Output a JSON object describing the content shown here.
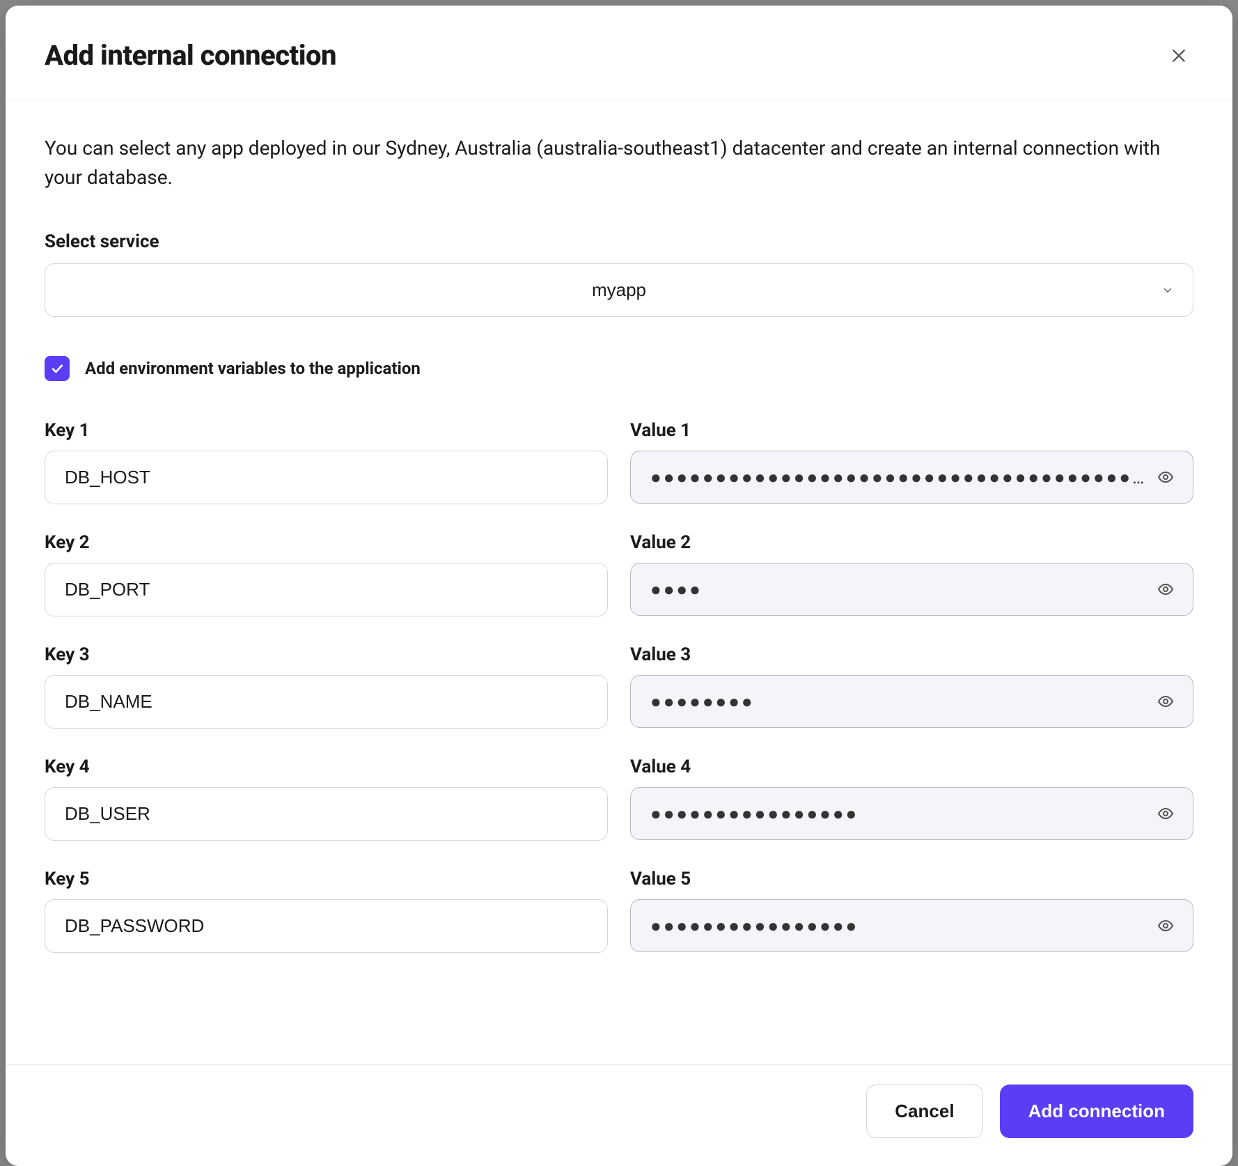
{
  "modal": {
    "title": "Add internal connection",
    "description": "You can select any app deployed in our Sydney, Australia (australia-southeast1) datacenter and create an internal connection with your database."
  },
  "service": {
    "label": "Select service",
    "value": "myapp"
  },
  "checkbox": {
    "label": "Add environment variables to the application",
    "checked": true
  },
  "env": [
    {
      "keyLabel": "Key 1",
      "key": "DB_HOST",
      "valueLabel": "Value 1",
      "value": "●●●●●●●●●●●●●●●●●●●●●●●●●●●●●●●●●●●●●●●●●●●●●●…"
    },
    {
      "keyLabel": "Key 2",
      "key": "DB_PORT",
      "valueLabel": "Value 2",
      "value": "●●●●"
    },
    {
      "keyLabel": "Key 3",
      "key": "DB_NAME",
      "valueLabel": "Value 3",
      "value": "●●●●●●●●"
    },
    {
      "keyLabel": "Key 4",
      "key": "DB_USER",
      "valueLabel": "Value 4",
      "value": "●●●●●●●●●●●●●●●●"
    },
    {
      "keyLabel": "Key 5",
      "key": "DB_PASSWORD",
      "valueLabel": "Value 5",
      "value": "●●●●●●●●●●●●●●●●"
    }
  ],
  "footer": {
    "cancel": "Cancel",
    "submit": "Add connection"
  }
}
